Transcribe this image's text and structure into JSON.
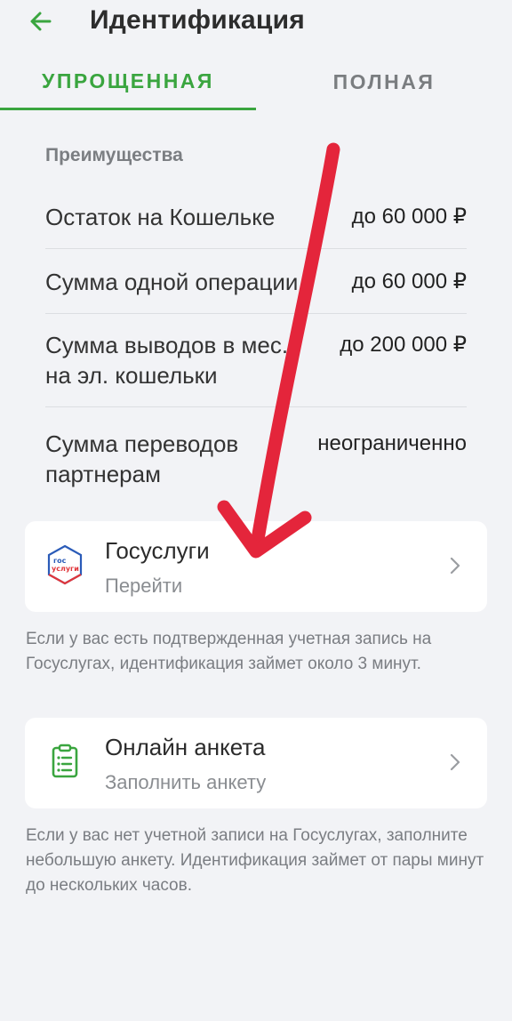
{
  "header": {
    "title": "Идентификация"
  },
  "tabs": [
    {
      "label": "УПРОЩЕННАЯ",
      "active": true
    },
    {
      "label": "ПОЛНАЯ",
      "active": false
    }
  ],
  "benefits": {
    "title": "Преимущества",
    "rows": [
      {
        "label": "Остаток на Кошельке",
        "value": "до 60 000 ₽"
      },
      {
        "label": "Сумма одной операции",
        "value": "до 60 000 ₽"
      },
      {
        "label": "Сумма выводов в мес.\nна эл. кошельки",
        "value": "до 200 000 ₽"
      },
      {
        "label": "Сумма переводов\nпартнерам",
        "value": "неограниченно"
      }
    ]
  },
  "gosuslugi_card": {
    "title": "Госуслуги",
    "subtitle": "Перейти",
    "logo_text_top": "гос",
    "logo_text_bottom": "услуги"
  },
  "gosuslugi_note": "Если у вас есть подтвержденная учетная запись на Госуслугах, идентификация займет около 3 минут.",
  "form_card": {
    "title": "Онлайн анкета",
    "subtitle": "Заполнить анкету"
  },
  "form_note": "Если у вас нет учетной записи на Госуслугах, заполните небольшую анкету. Идентификация займет от пары минут до нескольких часов.",
  "colors": {
    "accent_green": "#3aa53f",
    "annotation_red": "#e4253b",
    "background": "#f2f3f6"
  },
  "icons": {
    "back": "arrow-left-icon",
    "chevron": "chevron-right-icon",
    "clipboard": "clipboard-list-icon",
    "gosuslugi": "gosuslugi-logo-icon"
  }
}
